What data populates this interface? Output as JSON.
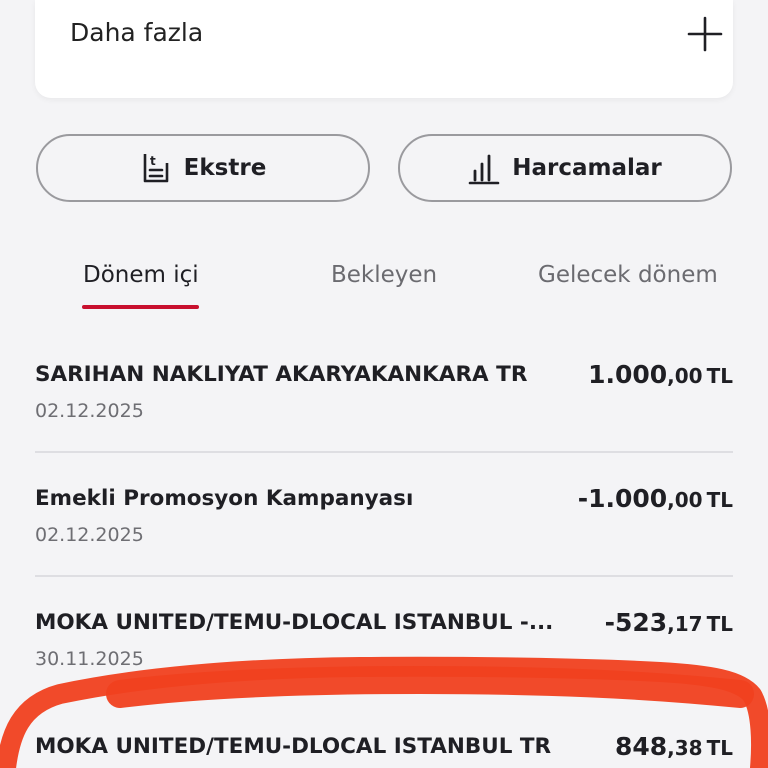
{
  "more_section": {
    "label": "Daha fazla",
    "icon": "plus-icon"
  },
  "actions": {
    "statement": {
      "label": "Ekstre",
      "icon": "statement-icon"
    },
    "spending": {
      "label": "Harcamalar",
      "icon": "bar-chart-icon"
    }
  },
  "tabs": [
    {
      "label": "Dönem içi",
      "active": true
    },
    {
      "label": "Bekleyen",
      "active": false
    },
    {
      "label": "Gelecek dönem",
      "active": false
    }
  ],
  "transactions": [
    {
      "title": "SARIHAN NAKLIYAT AKARYAKANKARA TR",
      "date": "02.12.2025",
      "amount_main": "1.000",
      "amount_frac": ",00",
      "currency": "TL"
    },
    {
      "title": "Emekli Promosyon Kampanyası",
      "date": "02.12.2025",
      "amount_main": "-1.000",
      "amount_frac": ",00",
      "currency": "TL"
    },
    {
      "title": "MOKA UNITED/TEMU-DLOCAL ISTANBUL -...",
      "date": "30.11.2025",
      "amount_main": "-523",
      "amount_frac": ",17",
      "currency": "TL"
    },
    {
      "title": "MOKA UNITED/TEMU-DLOCAL ISTANBUL TR",
      "date": "",
      "amount_main": "848",
      "amount_frac": ",38",
      "currency": "TL"
    }
  ],
  "colors": {
    "accent": "#c8102e",
    "marker": "#f0401f",
    "background": "#f4f4f6"
  }
}
